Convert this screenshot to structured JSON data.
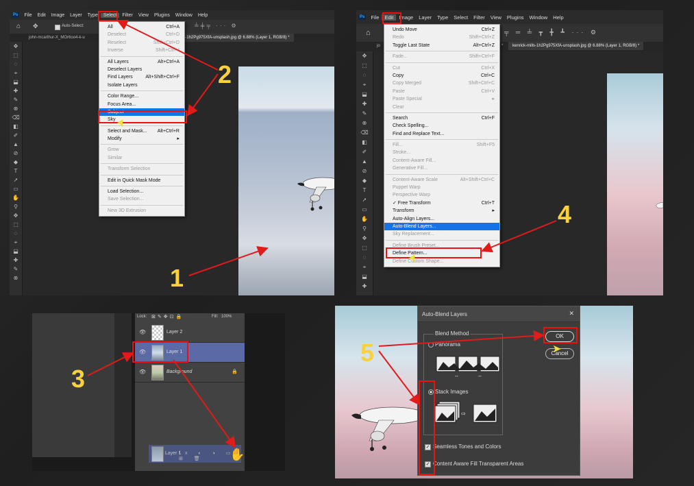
{
  "panel1": {
    "menubar": [
      "Ps",
      "File",
      "Edit",
      "Image",
      "Layer",
      "Type",
      "Select",
      "Filter",
      "View",
      "Plugins",
      "Window",
      "Help"
    ],
    "auto_select": "Auto-Select:",
    "tabs": [
      "john-mcarthur-X_MOr6oo4-k-u",
      "kenrick-mills-1h2Pg975XfA-unsplash.jpg @ 6.88% (Layer 1, RGB/8) *"
    ],
    "menu_items": [
      {
        "label": "All",
        "shortcut": "Ctrl+A",
        "disabled": false
      },
      {
        "label": "Deselect",
        "shortcut": "Ctrl+D",
        "disabled": true
      },
      {
        "label": "Reselect",
        "shortcut": "Shift+Ctrl+D",
        "disabled": true
      },
      {
        "label": "Inverse",
        "shortcut": "Shift+Ctrl+I",
        "disabled": true
      },
      {
        "sep": true
      },
      {
        "label": "All Layers",
        "shortcut": "Alt+Ctrl+A",
        "disabled": false
      },
      {
        "label": "Deselect Layers",
        "shortcut": "",
        "disabled": false
      },
      {
        "label": "Find Layers",
        "shortcut": "Alt+Shift+Ctrl+F",
        "disabled": false
      },
      {
        "label": "Isolate Layers",
        "shortcut": "",
        "disabled": false
      },
      {
        "sep": true
      },
      {
        "label": "Color Range...",
        "shortcut": "",
        "disabled": false
      },
      {
        "label": "Focus Area...",
        "shortcut": "",
        "disabled": false
      },
      {
        "label": "Subject",
        "shortcut": "",
        "disabled": false,
        "highlight": true
      },
      {
        "label": "Sky",
        "shortcut": "",
        "disabled": false
      },
      {
        "sep": true
      },
      {
        "label": "Select and Mask...",
        "shortcut": "Alt+Ctrl+R",
        "disabled": false
      },
      {
        "label": "Modify",
        "shortcut": "▸",
        "disabled": false
      },
      {
        "sep": true
      },
      {
        "label": "Grow",
        "shortcut": "",
        "disabled": true
      },
      {
        "label": "Similar",
        "shortcut": "",
        "disabled": true
      },
      {
        "sep": true
      },
      {
        "label": "Transform Selection",
        "shortcut": "",
        "disabled": true
      },
      {
        "sep": true
      },
      {
        "label": "Edit in Quick Mask Mode",
        "shortcut": "",
        "disabled": false
      },
      {
        "sep": true
      },
      {
        "label": "Load Selection...",
        "shortcut": "",
        "disabled": false
      },
      {
        "label": "Save Selection...",
        "shortcut": "",
        "disabled": true
      },
      {
        "sep": true
      },
      {
        "label": "New 3D Extrusion",
        "shortcut": "",
        "disabled": true
      }
    ]
  },
  "panel2": {
    "menubar": [
      "Ps",
      "File",
      "Edit",
      "Image",
      "Layer",
      "Type",
      "Select",
      "Filter",
      "View",
      "Plugins",
      "Window",
      "Help"
    ],
    "tabs": [
      "jo",
      "(RGB/8) *",
      "kenrick-mills-1h2Pg975XfA-unsplash.jpg @ 6.88% (Layer 1, RGB/8) *"
    ],
    "menu_items": [
      {
        "label": "Undo Move",
        "shortcut": "Ctrl+Z",
        "disabled": false
      },
      {
        "label": "Redo",
        "shortcut": "Shift+Ctrl+Z",
        "disabled": true
      },
      {
        "label": "Toggle Last State",
        "shortcut": "Alt+Ctrl+Z",
        "disabled": false
      },
      {
        "sep": true
      },
      {
        "label": "Fade...",
        "shortcut": "Shift+Ctrl+F",
        "disabled": true
      },
      {
        "sep": true
      },
      {
        "label": "Cut",
        "shortcut": "Ctrl+X",
        "disabled": true
      },
      {
        "label": "Copy",
        "shortcut": "Ctrl+C",
        "disabled": false
      },
      {
        "label": "Copy Merged",
        "shortcut": "Shift+Ctrl+C",
        "disabled": true
      },
      {
        "label": "Paste",
        "shortcut": "Ctrl+V",
        "disabled": true
      },
      {
        "label": "Paste Special",
        "shortcut": "▸",
        "disabled": true
      },
      {
        "label": "Clear",
        "shortcut": "",
        "disabled": true
      },
      {
        "sep": true
      },
      {
        "label": "Search",
        "shortcut": "Ctrl+F",
        "disabled": false
      },
      {
        "label": "Check Spelling...",
        "shortcut": "",
        "disabled": false
      },
      {
        "label": "Find and Replace Text...",
        "shortcut": "",
        "disabled": false
      },
      {
        "sep": true
      },
      {
        "label": "Fill...",
        "shortcut": "Shift+F5",
        "disabled": true
      },
      {
        "label": "Stroke...",
        "shortcut": "",
        "disabled": true
      },
      {
        "label": "Content-Aware Fill...",
        "shortcut": "",
        "disabled": true
      },
      {
        "label": "Generative Fill...",
        "shortcut": "",
        "disabled": true
      },
      {
        "sep": true
      },
      {
        "label": "Content-Aware Scale",
        "shortcut": "Alt+Shift+Ctrl+C",
        "disabled": true
      },
      {
        "label": "Puppet Warp",
        "shortcut": "",
        "disabled": true
      },
      {
        "label": "Perspective Warp",
        "shortcut": "",
        "disabled": true
      },
      {
        "label": "✓ Free Transform",
        "shortcut": "Ctrl+T",
        "disabled": false
      },
      {
        "label": "Transform",
        "shortcut": "▸",
        "disabled": false
      },
      {
        "label": "Auto-Align Layers...",
        "shortcut": "",
        "disabled": false
      },
      {
        "label": "Auto-Blend Layers...",
        "shortcut": "",
        "disabled": false,
        "highlight": true
      },
      {
        "label": "Sky Replacement...",
        "shortcut": "",
        "disabled": true
      },
      {
        "sep": true
      },
      {
        "label": "Define Brush Preset...",
        "shortcut": "",
        "disabled": true
      },
      {
        "label": "Define Pattern...",
        "shortcut": "",
        "disabled": false
      },
      {
        "label": "Define Custom Shape...",
        "shortcut": "",
        "disabled": true
      }
    ]
  },
  "panel3": {
    "lock_label": "Lock:",
    "fill_label": "Fill:",
    "fill_value": "100%",
    "layers": [
      {
        "name": "Layer 2",
        "selected": false
      },
      {
        "name": "Layer 1",
        "selected": true
      },
      {
        "name": "Background",
        "selected": false
      }
    ],
    "drag_layer": "Layer 1"
  },
  "panel4": {
    "title": "Auto-Blend Layers",
    "group_label": "Blend Method",
    "option_panorama": "Panorama",
    "option_stack": "Stack Images",
    "check1": "Seamless Tones and Colors",
    "check2": "Content Aware Fill Transparent Areas",
    "ok_label": "OK",
    "cancel_label": "Cancel",
    "close_glyph": "✕"
  },
  "steps": [
    "1",
    "2",
    "3",
    "4",
    "5"
  ],
  "colors": {
    "accent": "#1473e6",
    "annotation": "#e11a1a",
    "step_number": "#f7d23e"
  }
}
